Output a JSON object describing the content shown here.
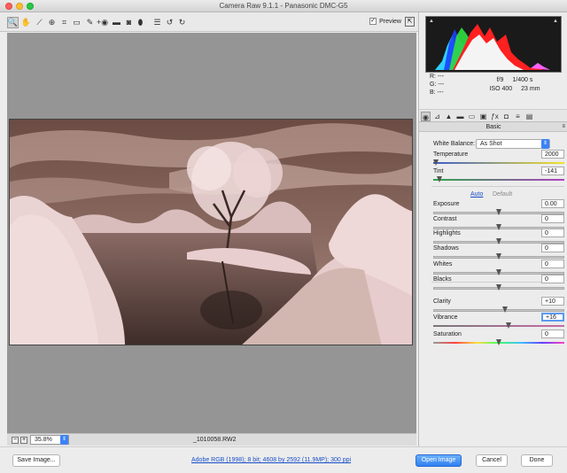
{
  "window": {
    "title": "Camera Raw 9.1.1  -  Panasonic DMC-G5"
  },
  "toolbar": {
    "tools": [
      {
        "name": "zoom-tool-icon",
        "glyph": "🔍"
      },
      {
        "name": "hand-tool-icon",
        "glyph": "✋"
      },
      {
        "name": "white-balance-tool-icon",
        "glyph": "⟋"
      },
      {
        "name": "color-sampler-tool-icon",
        "glyph": "⊕"
      },
      {
        "name": "crop-tool-icon",
        "glyph": "⌗"
      },
      {
        "name": "straighten-tool-icon",
        "glyph": "▭"
      },
      {
        "name": "spot-removal-tool-icon",
        "glyph": "✎"
      },
      {
        "name": "red-eye-tool-icon",
        "glyph": "+◉"
      },
      {
        "name": "adjustment-brush-icon",
        "glyph": "▬"
      },
      {
        "name": "graduated-filter-icon",
        "glyph": "◙"
      },
      {
        "name": "radial-filter-icon",
        "glyph": "⬮"
      },
      {
        "name": "preferences-icon",
        "glyph": "☰"
      },
      {
        "name": "rotate-left-icon",
        "glyph": "↺"
      },
      {
        "name": "rotate-right-icon",
        "glyph": "↻"
      }
    ],
    "preview_label": "Preview",
    "preview_checked": "✓"
  },
  "status": {
    "zoom_out": "−",
    "zoom_in": "+",
    "zoom": "35.8%",
    "filename": "_1010058.RW2"
  },
  "bottom": {
    "save_label": "Save Image...",
    "workflow_info": "Adobe RGB (1998); 8 bit; 4608 by 2592 (11.9MP); 300 ppi",
    "open_label": "Open Image",
    "cancel_label": "Cancel",
    "done_label": "Done"
  },
  "readout": {
    "r": "R:   ---",
    "g": "G:   ---",
    "b": "B:   ---",
    "aperture": "f/9",
    "shutter": "1/400 s",
    "iso": "ISO 400",
    "focal": "23 mm"
  },
  "panel": {
    "section_title": "Basic",
    "white_balance_label": "White Balance:",
    "white_balance_value": "As Shot",
    "auto_label": "Auto",
    "default_label": "Default",
    "sliders": [
      {
        "key": "temperature",
        "label": "Temperature",
        "value": "2000",
        "fraction": 0.0
      },
      {
        "key": "tint",
        "label": "Tint",
        "value": "-141",
        "fraction": 0.03
      },
      {
        "key": "exposure",
        "label": "Exposure",
        "value": "0.00",
        "fraction": 0.5
      },
      {
        "key": "contrast",
        "label": "Contrast",
        "value": "0",
        "fraction": 0.5
      },
      {
        "key": "highlights",
        "label": "Highlights",
        "value": "0",
        "fraction": 0.5
      },
      {
        "key": "shadows",
        "label": "Shadows",
        "value": "0",
        "fraction": 0.5
      },
      {
        "key": "whites",
        "label": "Whites",
        "value": "0",
        "fraction": 0.5
      },
      {
        "key": "blacks",
        "label": "Blacks",
        "value": "0",
        "fraction": 0.5
      },
      {
        "key": "clarity",
        "label": "Clarity",
        "value": "+10",
        "fraction": 0.55
      },
      {
        "key": "vibrance",
        "label": "Vibrance",
        "value": "+16",
        "fraction": 0.58
      },
      {
        "key": "saturation",
        "label": "Saturation",
        "value": "0",
        "fraction": 0.5
      }
    ]
  },
  "colors": {
    "accent": "#2f7ff0",
    "photo_sky": "#7a5a50",
    "photo_foliage": "#e8cfcf"
  }
}
